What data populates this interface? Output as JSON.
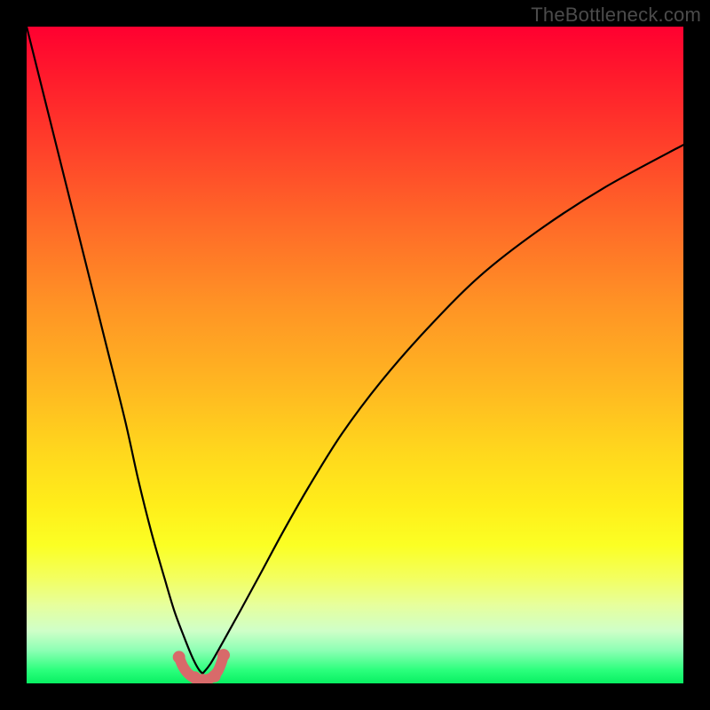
{
  "watermark": "TheBottleneck.com",
  "colors": {
    "background_black": "#000000",
    "gradient_top": "#ff0030",
    "gradient_bottom": "#08f062",
    "curve": "#000000",
    "marker": "#d86a6a"
  },
  "chart_data": {
    "type": "line",
    "title": "",
    "xlabel": "",
    "ylabel": "",
    "xlim": [
      0,
      100
    ],
    "ylim": [
      0,
      100
    ],
    "grid": false,
    "legend": false,
    "curve_left": {
      "description": "steep descending branch from top-left down to the valley",
      "x": [
        0,
        3,
        6,
        9,
        12,
        15,
        17,
        19,
        21,
        22.5,
        24,
        25,
        25.7,
        26.3,
        26.8
      ],
      "y": [
        100,
        88,
        76,
        64,
        52,
        40,
        31,
        23,
        16,
        11,
        7,
        4.5,
        3,
        2,
        1.5
      ]
    },
    "curve_right": {
      "description": "ascending branch from valley up toward top-right (decelerating)",
      "x": [
        26.8,
        28,
        30,
        32.5,
        35.5,
        39,
        43,
        48,
        54,
        61,
        69,
        78,
        88,
        100
      ],
      "y": [
        1.5,
        3,
        6.5,
        11,
        16.5,
        23,
        30,
        38,
        46,
        54,
        62,
        69,
        75.5,
        82
      ]
    },
    "valley_marker": {
      "description": "pink U-shaped marker segment at the curve's valley near y≈0",
      "x": [
        23.2,
        23.8,
        24.6,
        25.6,
        26.8,
        28.0,
        29.0,
        29.6,
        30.0
      ],
      "y": [
        4.0,
        2.6,
        1.5,
        0.8,
        0.5,
        0.8,
        1.7,
        3.0,
        4.3
      ]
    },
    "valley_marker_dots": {
      "x": [
        23.2,
        25.6,
        26.8,
        28.6,
        30.0
      ],
      "y": [
        4.0,
        0.9,
        0.5,
        1.1,
        4.3
      ]
    }
  }
}
